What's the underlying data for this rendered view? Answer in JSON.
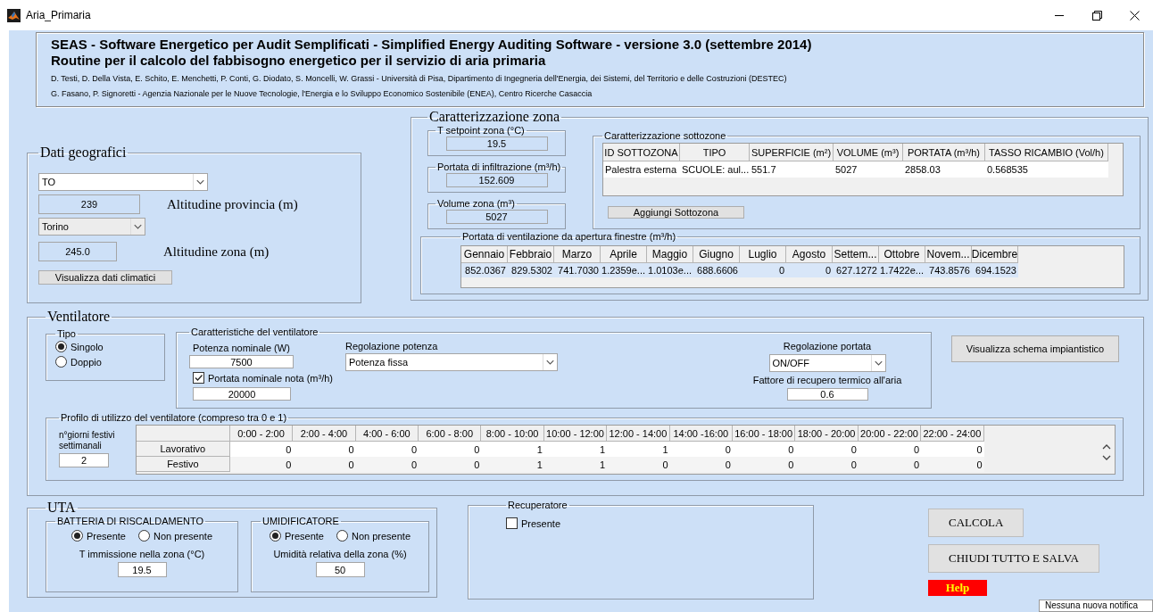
{
  "window": {
    "title": "Aria_Primaria"
  },
  "header": {
    "title": "SEAS - Software Energetico per Audit Semplificati - Simplified Energy Auditing Software - versione 3.0 (settembre 2014)",
    "subtitle": "Routine per il calcolo del fabbisogno energetico per il servizio di aria primaria",
    "authors": [
      "D. Testi, D. Della Vista, E. Schito, E. Menchetti, P. Conti, G. Diodato, S. Moncelli, W. Grassi - Università di Pisa, Dipartimento di Ingegneria dell'Energia, dei Sistemi, del Territorio e delle Costruzioni (DESTEC)",
      "G. Fasano, P. Signoretti - Agenzia Nazionale per le Nuove Tecnologie, l'Energia e lo Sviluppo Economico Sostenibile (ENEA), Centro Ricerche Casaccia"
    ]
  },
  "geo": {
    "title": "Dati geografici",
    "province": "TO",
    "province_altitude": "239",
    "province_altitude_label": "Altitudine provincia (m)",
    "city": "Torino",
    "zone_altitude": "245.0",
    "zone_altitude_label": "Altitudine zona (m)",
    "button": "Visualizza dati climatici"
  },
  "zone": {
    "title": "Caratterizzazione zona",
    "fields": [
      {
        "label": "T setpoint zona (°C)",
        "value": "19.5"
      },
      {
        "label": "Portata di infiltrazione (m³/h)",
        "value": "152.609"
      },
      {
        "label": "Volume zona (m³)",
        "value": "5027"
      }
    ],
    "subzones": {
      "title": "Caratterizzazione sottozone",
      "columns": [
        "ID SOTTOZONA",
        "TIPO",
        "SUPERFICIE (m²)",
        "VOLUME (m³)",
        "PORTATA (m³/h)",
        "TASSO RICAMBIO (Vol/h)"
      ],
      "rows": [
        [
          "Palestra esterna",
          "SCUOLE: aul...",
          "551.7",
          "5027",
          "2858.03",
          "0.568535"
        ]
      ],
      "button": "Aggiungi Sottozona"
    },
    "ventilation": {
      "title": "Portata di ventilazione da apertura finestre (m³/h)",
      "columns": [
        "Gennaio",
        "Febbraio",
        "Marzo",
        "Aprile",
        "Maggio",
        "Giugno",
        "Luglio",
        "Agosto",
        "Settem...",
        "Ottobre",
        "Novem...",
        "Dicembre"
      ],
      "values": [
        "852.0367",
        "829.5302",
        "741.7030",
        "1.2359e...",
        "1.0103e...",
        "688.6606",
        "0",
        "0",
        "627.1272",
        "1.7422e...",
        "743.8576",
        "694.1523"
      ]
    }
  },
  "fan": {
    "title": "Ventilatore",
    "type": {
      "title": "Tipo",
      "options": [
        {
          "label": "Singolo",
          "selected": true
        },
        {
          "label": "Doppio",
          "selected": false
        }
      ]
    },
    "characteristics": {
      "title": "Caratteristiche del ventilatore",
      "power_label": "Potenza nominale (W)",
      "power": "7500",
      "flow_known": {
        "label": "Portata nominale nota  (m³/h)",
        "checked": true
      },
      "flow": "20000",
      "power_regulation_label": "Regolazione potenza",
      "power_regulation": "Potenza fissa",
      "flow_regulation_label": "Regolazione portata",
      "flow_regulation": "ON/OFF",
      "recovery_label": "Fattore di recupero termico all'aria",
      "recovery": "0.6"
    },
    "schema_button": "Visualizza schema impiantistico",
    "profile": {
      "title": "Profilo di utilizzo del ventilatore (compreso tra 0 e 1)",
      "holidays_label": "n°giorni festivi settimanali",
      "holidays": "2",
      "columns": [
        "0:00 - 2:00",
        "2:00 - 4:00",
        "4:00 - 6:00",
        "6:00 - 8:00",
        "8:00 - 10:00",
        "10:00 - 12:00",
        "12:00 - 14:00",
        "14:00 -16:00",
        "16:00 - 18:00",
        "18:00 - 20:00",
        "20:00 - 22:00",
        "22:00 - 24:00"
      ],
      "rows": [
        {
          "label": "Lavorativo",
          "values": [
            "0",
            "0",
            "0",
            "0",
            "1",
            "1",
            "1",
            "0",
            "0",
            "0",
            "0",
            "0"
          ]
        },
        {
          "label": "Festivo",
          "values": [
            "0",
            "0",
            "0",
            "0",
            "1",
            "1",
            "0",
            "0",
            "0",
            "0",
            "0",
            "0"
          ]
        }
      ]
    }
  },
  "uta": {
    "title": "UTA",
    "groups": [
      {
        "title": "BATTERIA DI RISCALDAMENTO",
        "options": [
          {
            "label": "Presente",
            "selected": true
          },
          {
            "label": "Non presente",
            "selected": false
          }
        ],
        "field_label": "T immissione nella zona (°C)",
        "value": "19.5"
      },
      {
        "title": "UMIDIFICATORE",
        "options": [
          {
            "label": "Presente",
            "selected": true
          },
          {
            "label": "Non presente",
            "selected": false
          }
        ],
        "field_label": "Umidità relativa della zona (%)",
        "value": "50"
      }
    ]
  },
  "recuperator": {
    "title": "Recuperatore",
    "present": {
      "label": "Presente",
      "checked": false
    }
  },
  "actions": [
    {
      "label": "CALCOLA",
      "kind": "normal"
    },
    {
      "label": "CHIUDI TUTTO E SALVA",
      "kind": "normal"
    },
    {
      "label": "Help",
      "kind": "help"
    }
  ],
  "notification": "Nessuna nuova notifica"
}
